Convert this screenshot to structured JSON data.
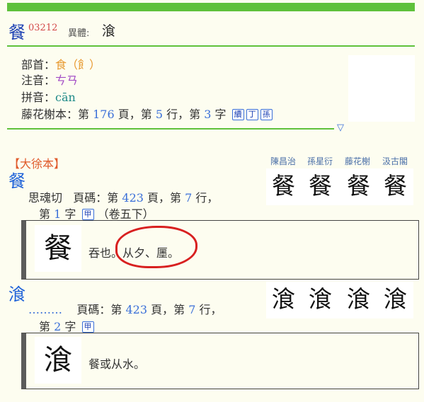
{
  "header": {
    "char": "餐",
    "code": "03212",
    "variant_label": "異體:",
    "variant_char": "湌"
  },
  "info": {
    "radical_label": "部首：",
    "radical_value": "食（飠）",
    "zhuyin_label": "注音：",
    "zhuyin_value": "ㄘㄢ",
    "pinyin_label": "拼音：",
    "pinyin_value": "cān",
    "fujisawa_label": "藤花榭本：第",
    "page": "176",
    "page_unit": "頁，第",
    "row": "5",
    "row_unit": "行，第",
    "col": "3",
    "col_unit": "字",
    "buttons": [
      "續",
      "丁",
      "孫"
    ]
  },
  "section": {
    "title": "【大徐本】",
    "editions": [
      "陳昌治",
      "孫星衍",
      "藤花榭",
      "汲古閣"
    ]
  },
  "entries": [
    {
      "char": "餐",
      "fanqie": "思魂切",
      "page_label": "頁碼：第",
      "page": "423",
      "page_unit": "頁，第",
      "row": "7",
      "row_unit": "行，",
      "line2_prefix": "第",
      "col": "1",
      "col_unit": "字",
      "badge": "甲",
      "volume": "（卷五下）",
      "glyphs": [
        "餐",
        "餐",
        "餐",
        "餐"
      ],
      "quote_glyph": "餐",
      "quote": "吞也。从夕、",
      "quote_tail": "㕓。"
    },
    {
      "char": "湌",
      "fanqie": "………",
      "page_label": "頁碼：第",
      "page": "423",
      "page_unit": "頁，第",
      "row": "7",
      "row_unit": "行，",
      "line2_prefix": "第",
      "col": "2",
      "col_unit": "字",
      "badge": "甲",
      "glyphs": [
        "湌",
        "湌",
        "湌",
        "湌"
      ],
      "quote_glyph": "湌",
      "quote": "餐或从水。"
    }
  ]
}
